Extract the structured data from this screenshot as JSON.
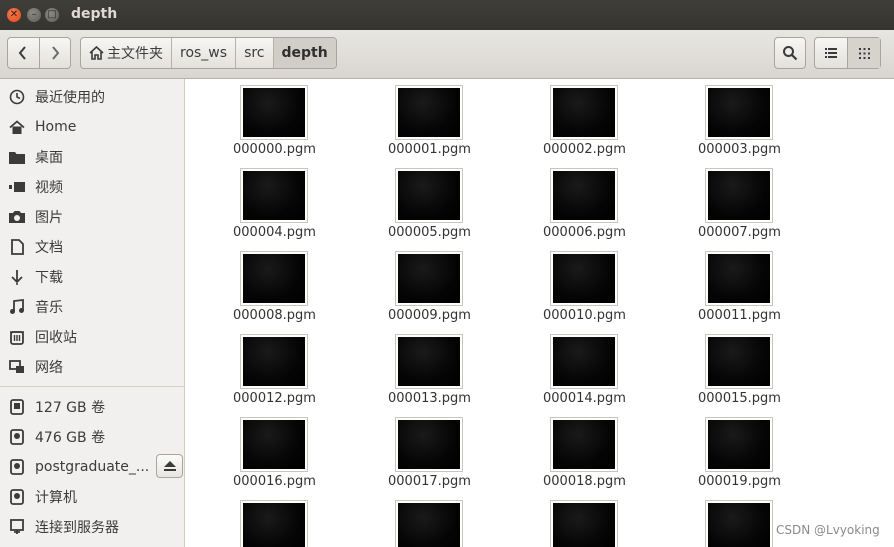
{
  "window": {
    "title": "depth",
    "buttons": [
      "close",
      "minimize",
      "maximize"
    ]
  },
  "toolbar": {
    "back_icon": "chevron-left-icon",
    "forward_icon": "chevron-right-icon",
    "breadcrumbs": [
      "主文件夹",
      "ros_ws",
      "src",
      "depth"
    ],
    "active_crumb": "depth",
    "search_icon": "search-icon",
    "view_list_icon": "list-view-icon",
    "view_grid_icon": "grid-view-icon"
  },
  "sidebar": {
    "places": [
      {
        "label": "最近使用的",
        "icon": "clock-icon"
      },
      {
        "label": "Home",
        "icon": "home-icon"
      },
      {
        "label": "桌面",
        "icon": "folder-icon"
      },
      {
        "label": "视频",
        "icon": "video-icon"
      },
      {
        "label": "图片",
        "icon": "camera-icon"
      },
      {
        "label": "文档",
        "icon": "document-icon"
      },
      {
        "label": "下载",
        "icon": "download-icon"
      },
      {
        "label": "音乐",
        "icon": "music-icon"
      },
      {
        "label": "回收站",
        "icon": "trash-icon"
      },
      {
        "label": "网络",
        "icon": "network-icon"
      }
    ],
    "devices": [
      {
        "label": "127 GB 卷",
        "icon": "drive-icon"
      },
      {
        "label": "476 GB 卷",
        "icon": "drive-icon"
      },
      {
        "label": "postgraduate_...",
        "icon": "drive-icon"
      },
      {
        "label": "计算机",
        "icon": "drive-icon"
      },
      {
        "label": "连接到服务器",
        "icon": "server-icon"
      }
    ],
    "eject_icon": "eject-icon"
  },
  "files": [
    "000000.pgm",
    "000001.pgm",
    "000002.pgm",
    "000003.pgm",
    "000004.pgm",
    "000005.pgm",
    "000006.pgm",
    "000007.pgm",
    "000008.pgm",
    "000009.pgm",
    "000010.pgm",
    "000011.pgm",
    "000012.pgm",
    "000013.pgm",
    "000014.pgm",
    "000015.pgm",
    "000016.pgm",
    "000017.pgm",
    "000018.pgm",
    "000019.pgm",
    "",
    "",
    "",
    ""
  ],
  "watermark": "CSDN @Lvyoking"
}
